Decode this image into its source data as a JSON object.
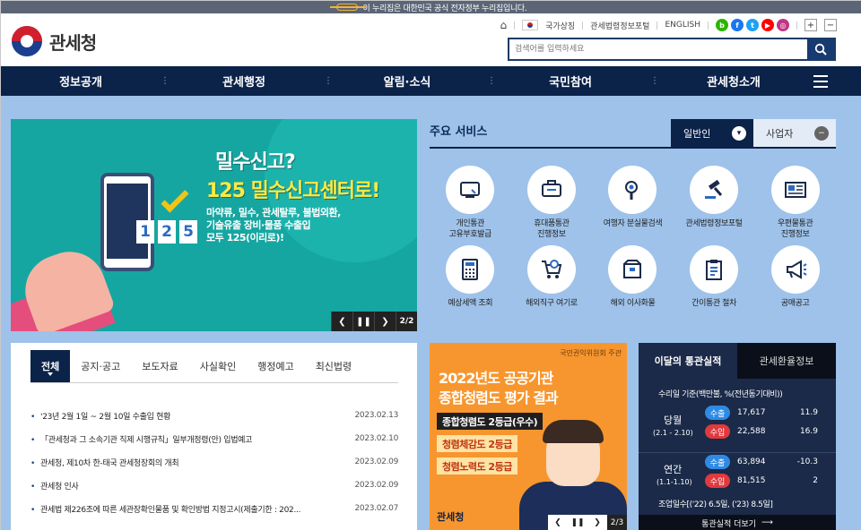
{
  "gov_bar": {
    "text": "이 누리집은 대한민국 공식 전자정부 누리집입니다."
  },
  "logo": {
    "text": "관세청"
  },
  "util": {
    "home": "⌂",
    "national_symbol": "국가상징",
    "portal": "관세법령정보포털",
    "english": "ENGLISH",
    "sns": [
      {
        "label": "b",
        "color": "#2db400"
      },
      {
        "label": "f",
        "color": "#1877f2"
      },
      {
        "label": "t",
        "color": "#1da1f2"
      },
      {
        "label": "▶",
        "color": "#ff0000"
      },
      {
        "label": "◎",
        "color": "#c13584"
      }
    ],
    "zoom_in": "+",
    "zoom_out": "−"
  },
  "search": {
    "placeholder": "검색어를 입력하세요"
  },
  "nav": {
    "items": [
      "정보공개",
      "관세행정",
      "알림·소식",
      "국민참여",
      "관세청소개"
    ]
  },
  "banner": {
    "headline1": "밀수신고?",
    "headline2": "125 밀수신고센터로!",
    "line1": "마약류, 밀수, 관세탈루, 불법외환,",
    "line2": "기술유출 장비·물품 수출입",
    "line3": "모두 125(이리로)!",
    "digits": [
      "1",
      "2",
      "5"
    ],
    "page": "2/2"
  },
  "services": {
    "title": "주요 서비스",
    "tab_active": "일반인",
    "tab_inactive": "사업자",
    "items": [
      {
        "label": "개인통관\n고유부호발급",
        "icon": "id-card-icon"
      },
      {
        "label": "휴대품통관\n진행정보",
        "icon": "luggage-icon"
      },
      {
        "label": "여행자 분실물검색",
        "icon": "magnifier-icon"
      },
      {
        "label": "관세법령정보포털",
        "icon": "gavel-icon"
      },
      {
        "label": "우편물통관\n진행정보",
        "icon": "mail-icon"
      },
      {
        "label": "예상세액 조회",
        "icon": "calculator-icon"
      },
      {
        "label": "해외직구 여기로",
        "icon": "cart-icon"
      },
      {
        "label": "해외 이사화물",
        "icon": "box-icon"
      },
      {
        "label": "간이통관 절차",
        "icon": "clipboard-icon"
      },
      {
        "label": "공매공고",
        "icon": "megaphone-icon"
      }
    ]
  },
  "news": {
    "tabs": [
      "전체",
      "공지·공고",
      "보도자료",
      "사실확인",
      "행정예고",
      "최신법령"
    ],
    "rows": [
      {
        "title": "'23년 2월 1일 ~ 2월 10일 수출입 현황",
        "date": "2023.02.13"
      },
      {
        "title": "「관세청과 그 소속기관 직제 시행규칙」일부개정령(안) 입법예고",
        "date": "2023.02.10"
      },
      {
        "title": "관세청, 제10차 한-태국 관세청장회의 개최",
        "date": "2023.02.09"
      },
      {
        "title": "관세청 인사",
        "date": "2023.02.09"
      },
      {
        "title": "관세법 제226조에 따른 세관장확인물품 및 확인방법 지정고시(제출기한 : 202...",
        "date": "2023.02.07"
      }
    ]
  },
  "promo": {
    "org": "국민권익위원회 주관",
    "line1": "2022년도 공공기관",
    "line2": "종합청렴도 평가 결과",
    "badge1": "종합청렴도 2등급(우수)",
    "badge2": "청렴체감도 2등급",
    "badge3": "청렴노력도 2등급",
    "org_mark": "관세청",
    "page": "2/3"
  },
  "stats": {
    "tab_active": "이달의 통관실적",
    "tab_inactive": "관세환율정보",
    "basis": "수리일 기준(백만불, %(전년동기대비))",
    "monthly": {
      "name": "당월",
      "period": "(2.1 - 2.10)",
      "export_label": "수출",
      "export_value": "17,617",
      "export_rate": "11.9",
      "import_label": "수입",
      "import_value": "22,588",
      "import_rate": "16.9"
    },
    "yearly": {
      "name": "연간",
      "period": "(1.1-1.10)",
      "export_label": "수출",
      "export_value": "63,894",
      "export_rate": "-10.3",
      "import_label": "수입",
      "import_value": "81,515",
      "import_rate": "2"
    },
    "days": "조업일수[('22) 6.5일, ('23) 8.5일]",
    "more": "통관실적 더보기"
  },
  "colors": {
    "navy": "#0b2249",
    "bg": "#9ec2ea",
    "export": "#2e8ae6",
    "import": "#e0393e"
  }
}
